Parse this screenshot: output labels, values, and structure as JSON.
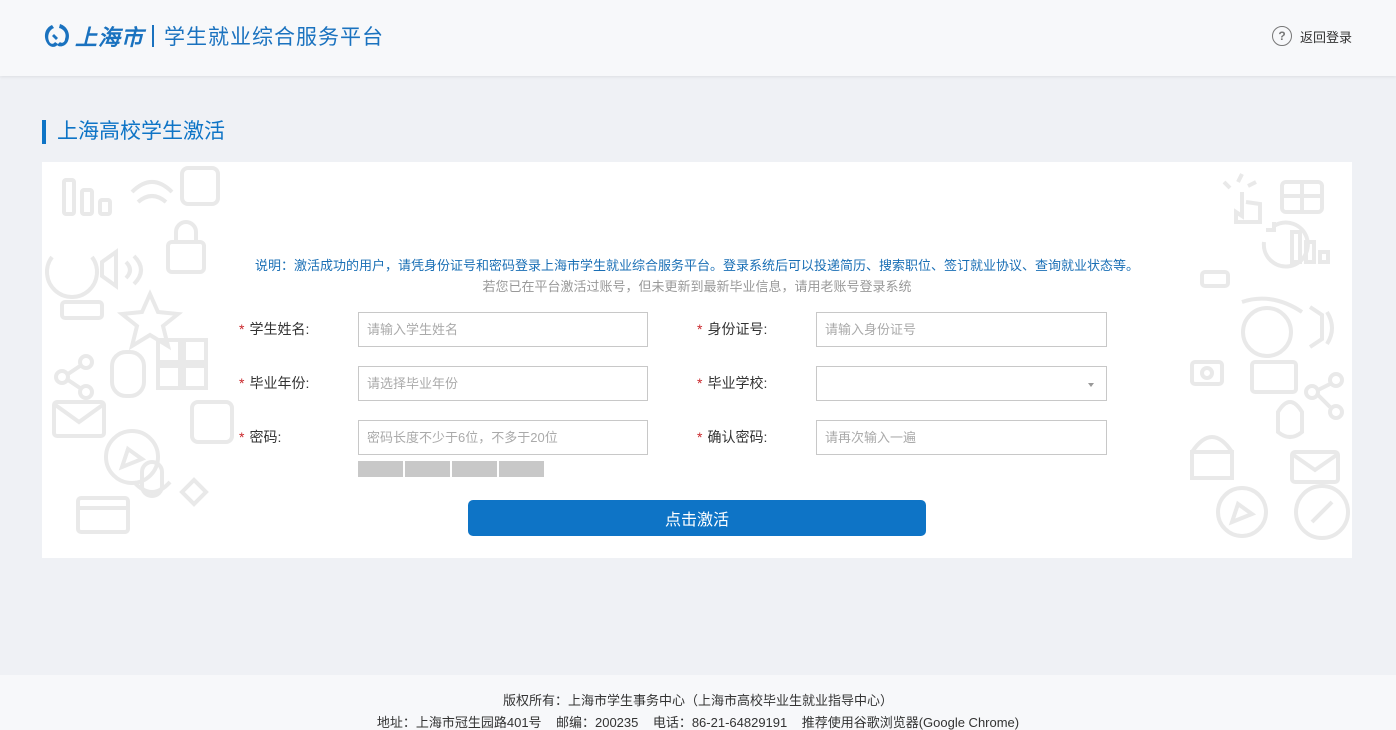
{
  "header": {
    "city_logo": "上海市",
    "platform_name": "学生就业综合服务平台",
    "back_login": "返回登录",
    "help_icon_glyph": "?"
  },
  "page": {
    "title": "上海高校学生激活"
  },
  "notice": {
    "line1": "说明：激活成功的用户，请凭身份证号和密码登录上海市学生就业综合服务平台。登录系统后可以投递简历、搜索职位、签订就业协议、查询就业状态等。",
    "line2": "若您已在平台激活过账号，但未更新到最新毕业信息，请用老账号登录系统"
  },
  "form": {
    "required_mark": "*",
    "student_name": {
      "label": "学生姓名:",
      "placeholder": "请输入学生姓名",
      "value": ""
    },
    "id_number": {
      "label": "身份证号:",
      "placeholder": "请输入身份证号",
      "value": ""
    },
    "grad_year": {
      "label": "毕业年份:",
      "placeholder": "请选择毕业年份",
      "value": ""
    },
    "school": {
      "label": "毕业学校:",
      "value": ""
    },
    "password": {
      "label": "密码:",
      "placeholder": "密码长度不少于6位，不多于20位",
      "value": ""
    },
    "confirm_password": {
      "label": "确认密码:",
      "placeholder": "请再次输入一遍",
      "value": ""
    },
    "password_strength_level": 0,
    "submit_label": "点击激活"
  },
  "footer": {
    "line1": "版权所有：上海市学生事务中心（上海市高校毕业生就业指导中心）",
    "line2": "地址：上海市冠生园路401号    邮编：200235    电话：86-21-64829191    推荐使用谷歌浏览器(Google Chrome)"
  },
  "colors": {
    "brand": "#0e74c6",
    "required": "#c9262a",
    "notice": "#1a6fb5",
    "background": "#eff1f5"
  }
}
